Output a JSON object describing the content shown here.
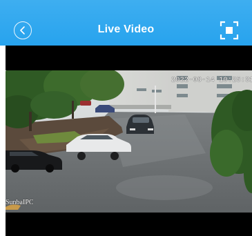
{
  "header": {
    "title": "Live Video",
    "back_icon": "chevron-left-icon",
    "fullscreen_icon": "fullscreen-icon"
  },
  "video": {
    "timestamp_overlay": "2022-08-14 10:25:31",
    "camera_name_overlay": "SunbaIPC"
  },
  "colors": {
    "header_background": "#2ea7ef",
    "header_text": "#ffffff",
    "player_background": "#000000"
  }
}
